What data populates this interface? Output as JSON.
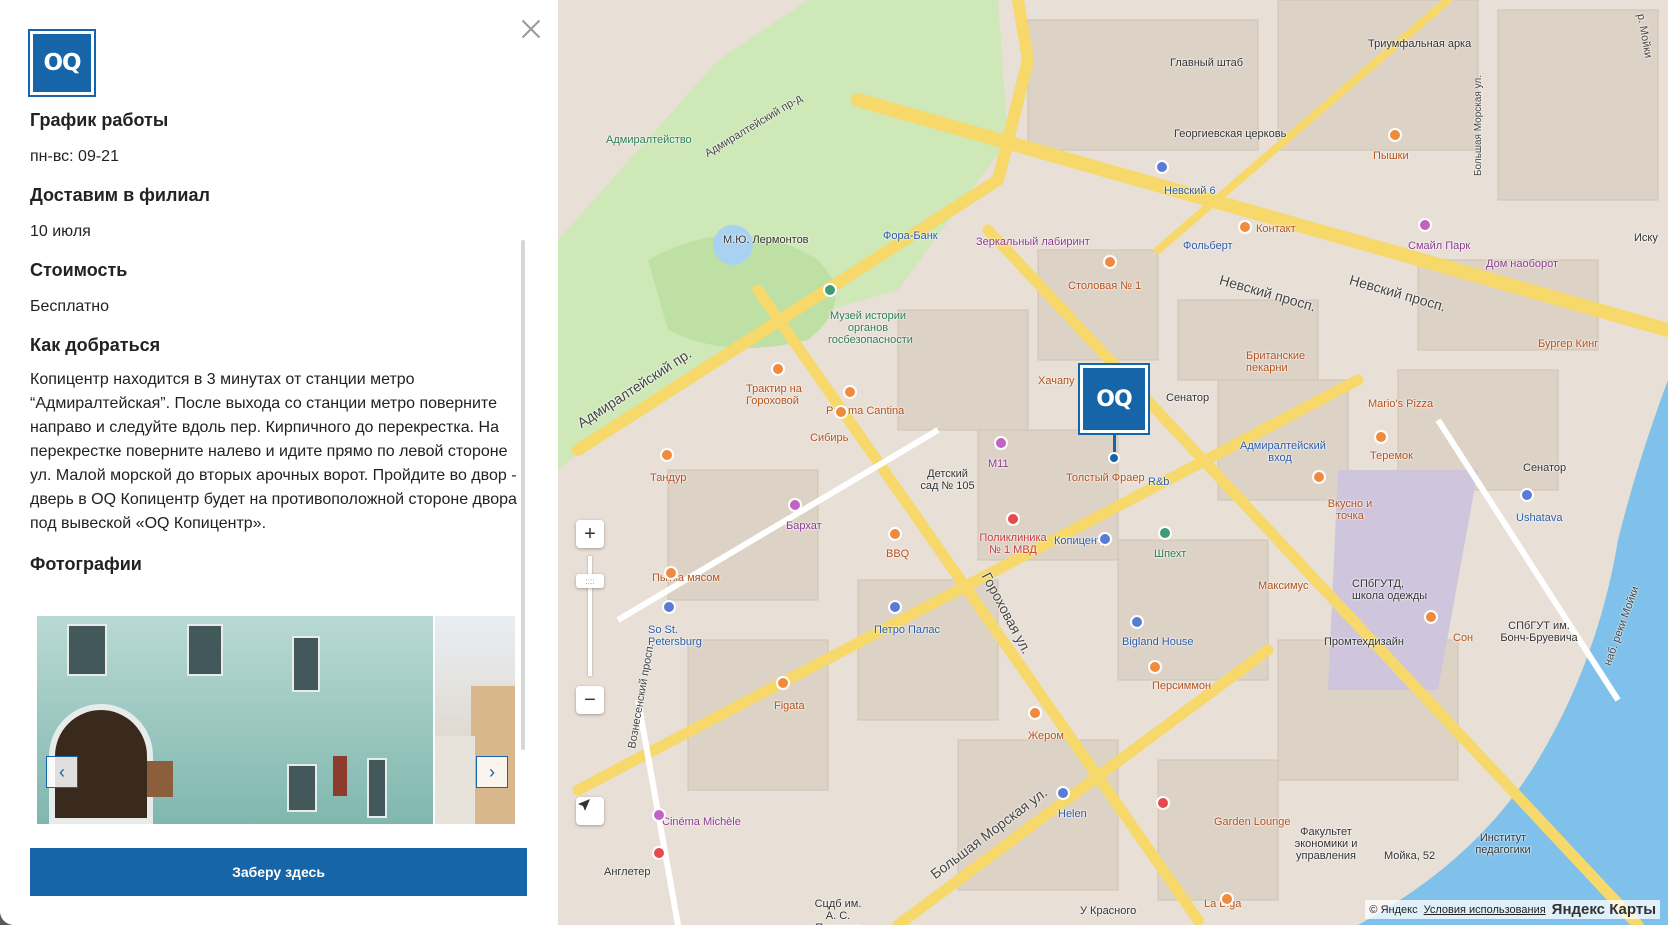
{
  "panel": {
    "logo_text": "OQ",
    "sections": [
      {
        "heading": "Грaфик работы",
        "text": "пн-вс: 09-21"
      },
      {
        "heading": "Доставим в филиал",
        "text": "10 июля"
      },
      {
        "heading": "Стоимость",
        "text": "Бесплатно"
      },
      {
        "heading": "Как добраться",
        "text": "Копицентр находится в 3 минутах от станции метро “Адмиралтейская”. После выхода со станции метро поверните направо и следуйте вдоль пер. Кирпичного до перекрестка. На перекрестке поверните налево и идите прямо по левой стороне ул. Малой морской до вторых арочных ворот. Пройдите во двор - дверь в OQ Копицентр будет на противоположной стороне двора под вывеской «OQ Копицентр»."
      }
    ],
    "photos_heading": "Фотографии",
    "gallery_prev": "‹",
    "gallery_next": "›",
    "cta_label": "Заберу здесь"
  },
  "map": {
    "pin_text": "OQ",
    "zoom_in": "+",
    "zoom_out": "−",
    "zoom_handle": "::::",
    "attribution": "© Яндекс",
    "terms": "Условия использования",
    "brand": "Яндекс Карты",
    "labels": {
      "admiralteystvo": "Адмиралтейство",
      "admiralteysky_pr": "Адмиралтейский пр.",
      "admiralteysky_prd": "Адмиралтейский пр-д",
      "lermontov": "М.Ю. Лермонтов",
      "glavny_shtab": "Главный штаб",
      "triumf_arka": "Триумфальная арка",
      "georg_church": "Георгиевская церковь",
      "pyshki": "Пышки",
      "nevsky6": "Невский 6",
      "fora_bank": "Фора-Банк",
      "zerkalny": "Зеркальный лабиринт",
      "folbert": "Фольберт",
      "kontakt": "Контакт",
      "smail_park": "Смайл Парк",
      "dom_naoborot": "Дом наоборот",
      "stolovaya": "Столовая № 1",
      "nevsky1": "Невский просп.",
      "nevsky2": "Невский просп.",
      "muzey": "Музей истории органов госбезопасности",
      "british": "Британские пекарни",
      "burger_king": "Бургер Кинг",
      "traktir": "Трактир на Гороховой",
      "paloma": "Paloma Cantina",
      "sibir": "Сибирь",
      "senator1": "Сенатор",
      "marios": "Mario's Pizza",
      "hachapuri": "Хачапу",
      "admiralteysky_vhod": "Адмиралтейский вход",
      "teremok": "Теремок",
      "senator2": "Сенатор",
      "tandur": "Тандур",
      "detsky_sad": "Детский сад № 105",
      "m11": "M11",
      "tolsty": "Толстый Фраер",
      "rb": "R&b",
      "vkusno": "Вкусно и точка",
      "ushatava": "Ushatava",
      "barhat": "Бархат",
      "bbq": "BBQ",
      "poliklinika": "Поликлиника № 1 МВД",
      "kopicentr": "Копицентр",
      "shpekht": "Шпехт",
      "maksimus": "Максимус",
      "spbgutd": "СПбГУТД, школа одежды",
      "pytka": "Пытка мясом",
      "gorohovaya": "Гороховая ул.",
      "so_st": "So St. Petersburg",
      "petro": "Петро Палас",
      "bigland": "Bigland House",
      "promtech": "Промтехдизайн",
      "son": "Сон",
      "spbgut": "СПбГУТ им. Бонч-Бруевича",
      "persimmon": "Персиммон",
      "figata": "Figata",
      "voznes": "Вознесенский просп.",
      "zherom": "Жером",
      "bolshaya_morskaya": "Большая Морская ул.",
      "helen": "Helen",
      "garden": "Garden Lounge",
      "cinema": "Cinéma Michèle",
      "fakultet": "Факультет экономики и управления",
      "moyka52": "Мойка, 52",
      "institut": "Институт педагогики",
      "angleter": "Англетер",
      "la_biga": "La Biga",
      "sudsb": "Сцдб им. А. С. Пушкина",
      "u_krasnogo": "У Красного",
      "iskus": "Иску",
      "moyki": "р. Мойки",
      "nab_moyki": "наб. реки Мойки",
      "bolsh_morsk_ul": "Большая Морская ул."
    }
  }
}
